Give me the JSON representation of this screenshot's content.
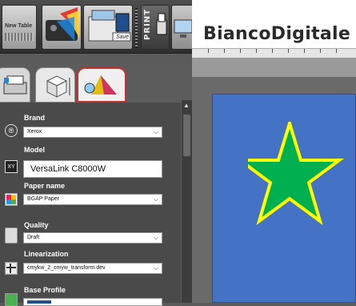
{
  "toolbar": {
    "new_table_label": "New Table",
    "save_label": "Save",
    "print_label": "PRINT"
  },
  "header": {
    "brand": "BiancoDigitale"
  },
  "panel": {
    "brand": {
      "label": "Brand",
      "value": "Xerox"
    },
    "model": {
      "label": "Model",
      "value": "VersaLink C8000W"
    },
    "paper": {
      "label": "Paper name",
      "value": "BGAP Paper"
    },
    "quality": {
      "label": "Quality",
      "value": "Draft"
    },
    "linearization": {
      "label": "Linearization",
      "value": "cmykw_2_cmyw_transform.dev"
    },
    "base_profile": {
      "label": "Base Profile"
    }
  },
  "icons": {
    "registered": "®",
    "xy": "XY",
    "chevron": "⌵",
    "scroll_up": "▲"
  },
  "colors": {
    "page_bg": "#4472c4",
    "star_fill": "#00b050",
    "star_stroke": "#ffff00",
    "tab_active_border": "#c9302c"
  }
}
